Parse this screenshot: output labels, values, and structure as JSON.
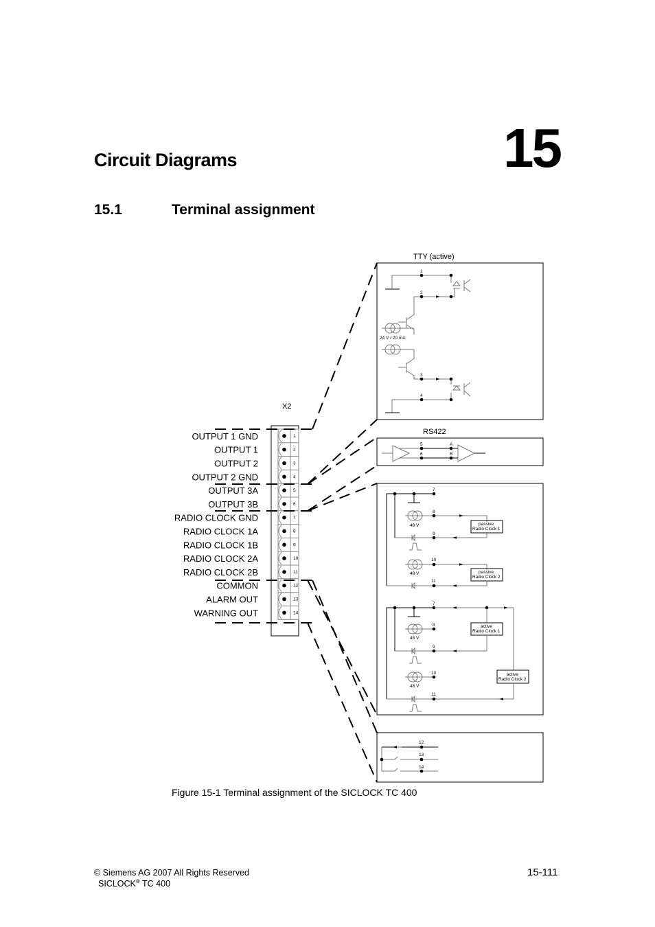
{
  "chapter": {
    "title": "Circuit Diagrams",
    "number": "15"
  },
  "section": {
    "number": "15.1",
    "title": "Terminal assignment"
  },
  "connector": {
    "name": "X2",
    "terminals": [
      {
        "pin": "1",
        "label": "OUTPUT 1 GND"
      },
      {
        "pin": "2",
        "label": "OUTPUT 1"
      },
      {
        "pin": "3",
        "label": "OUTPUT 2"
      },
      {
        "pin": "4",
        "label": "OUTPUT 2 GND"
      },
      {
        "pin": "5",
        "label": "OUTPUT 3A"
      },
      {
        "pin": "6",
        "label": "OUTPUT 3B"
      },
      {
        "pin": "7",
        "label": "RADIO CLOCK GND"
      },
      {
        "pin": "8",
        "label": "RADIO CLOCK 1A"
      },
      {
        "pin": "9",
        "label": "RADIO CLOCK 1B"
      },
      {
        "pin": "10",
        "label": "RADIO CLOCK 2A"
      },
      {
        "pin": "11",
        "label": "RADIO CLOCK 2B"
      },
      {
        "pin": "12",
        "label": "COMMON"
      },
      {
        "pin": "13",
        "label": "ALARM OUT"
      },
      {
        "pin": "14",
        "label": "WARNING OUT"
      }
    ]
  },
  "tty": {
    "title": "TTY (active)",
    "source_label": "24 V / 20 mA",
    "pins": [
      "1",
      "2",
      "3",
      "4"
    ]
  },
  "rs422": {
    "title": "RS422",
    "pins": [
      "5",
      "6"
    ],
    "lines": [
      "A",
      "B"
    ]
  },
  "radio_passive": {
    "pins": [
      "7",
      "8",
      "9",
      "10",
      "11"
    ],
    "source_label": "48 V",
    "clock1": [
      "passive",
      "Radio Clock 1"
    ],
    "clock2": [
      "passive",
      "Radio Clock 2"
    ]
  },
  "radio_active": {
    "pins": [
      "7",
      "8",
      "9",
      "10",
      "11"
    ],
    "source_label": "48 V",
    "clock1": [
      "active",
      "Radio Clock 1"
    ],
    "clock2": [
      "active",
      "Radio Clock 2"
    ]
  },
  "relay": {
    "pins": [
      "12",
      "13",
      "14"
    ]
  },
  "caption": "Figure 15-1 Terminal assignment of the SICLOCK TC 400",
  "footer": {
    "copyright": "© Siemens AG 2007 All Rights Reserved",
    "product": "SICLOCK",
    "product_mark": "®",
    "product_model": "TC 400",
    "page_number": "15-111"
  }
}
